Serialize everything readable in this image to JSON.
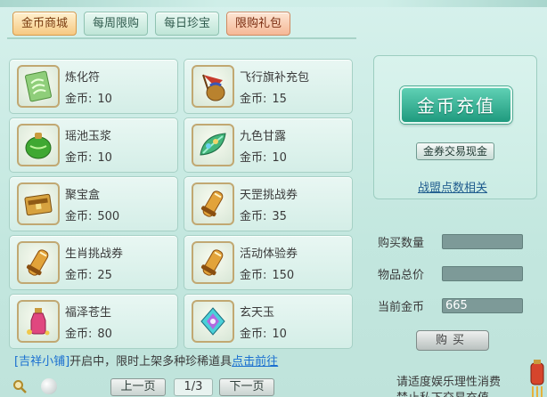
{
  "tabs": [
    {
      "label": "金币商城",
      "active": true
    },
    {
      "label": "每周限购",
      "active": false
    },
    {
      "label": "每日珍宝",
      "active": false
    },
    {
      "label": "限购礼包",
      "active": false
    }
  ],
  "currency_label": "金币:",
  "items": [
    {
      "name": "炼化符",
      "price": "10",
      "icon": "scroll-talisman-icon"
    },
    {
      "name": "飞行旗补充包",
      "price": "15",
      "icon": "flag-pouch-icon"
    },
    {
      "name": "瑶池玉浆",
      "price": "10",
      "icon": "jade-potion-gourd-icon"
    },
    {
      "name": "九色甘露",
      "price": "10",
      "icon": "nine-color-leaf-icon"
    },
    {
      "name": "聚宝盒",
      "price": "500",
      "icon": "treasure-box-icon"
    },
    {
      "name": "天罡挑战券",
      "price": "35",
      "icon": "challenge-scroll-icon"
    },
    {
      "name": "生肖挑战券",
      "price": "25",
      "icon": "zodiac-scroll-icon"
    },
    {
      "name": "活动体验券",
      "price": "150",
      "icon": "event-scroll-icon"
    },
    {
      "name": "福泽苍生",
      "price": "80",
      "icon": "blessing-bottle-icon"
    },
    {
      "name": "玄天玉",
      "price": "10",
      "icon": "mystic-jade-icon"
    }
  ],
  "notice": {
    "shop": "[吉祥小铺]",
    "text": "开启中，限时上架多种珍稀道具",
    "link": "点击前往"
  },
  "pager": {
    "prev": "上一页",
    "page": "1/3",
    "next": "下一页"
  },
  "side": {
    "recharge": "金币充值",
    "exchange": "金券交易现金",
    "league": "战盟点数相关",
    "qty_label": "购买数量",
    "qty_value": "",
    "total_label": "物品总价",
    "total_value": "",
    "gold_label": "当前金币",
    "gold_value": "665",
    "buy": "购买"
  },
  "advice": {
    "line1": "请适度娱乐理性消费",
    "line2": "禁止私下交易充值"
  }
}
